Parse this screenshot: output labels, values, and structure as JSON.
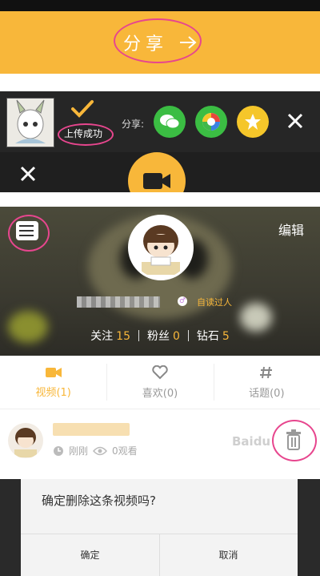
{
  "share_panel": {
    "label": "分享"
  },
  "upload_panel": {
    "status": "上传成功",
    "share_label": "分享:",
    "share_targets": [
      "wechat-icon",
      "moments-icon",
      "qzone-icon"
    ]
  },
  "profile": {
    "edit_label": "编辑",
    "bio": "自读过人",
    "stats": [
      {
        "label": "关注",
        "value": "15"
      },
      {
        "label": "粉丝",
        "value": "0"
      },
      {
        "label": "钻石",
        "value": "5"
      }
    ]
  },
  "tabs": [
    {
      "label": "视频(1)",
      "icon": "video-camera-icon"
    },
    {
      "label": "喜欢(0)",
      "icon": "heart-icon"
    },
    {
      "label": "话题(0)",
      "icon": "hashtag-icon"
    }
  ],
  "video_item": {
    "time": "刚刚",
    "views": "0观看"
  },
  "watermark": "Baidu",
  "dialog": {
    "question": "确定删除这条视频吗?",
    "confirm": "确定",
    "cancel": "取消"
  },
  "colors": {
    "accent": "#f8b73a",
    "annotation": "#e7468e",
    "wechat": "#3bbd43",
    "qzone": "#f5c62a"
  }
}
